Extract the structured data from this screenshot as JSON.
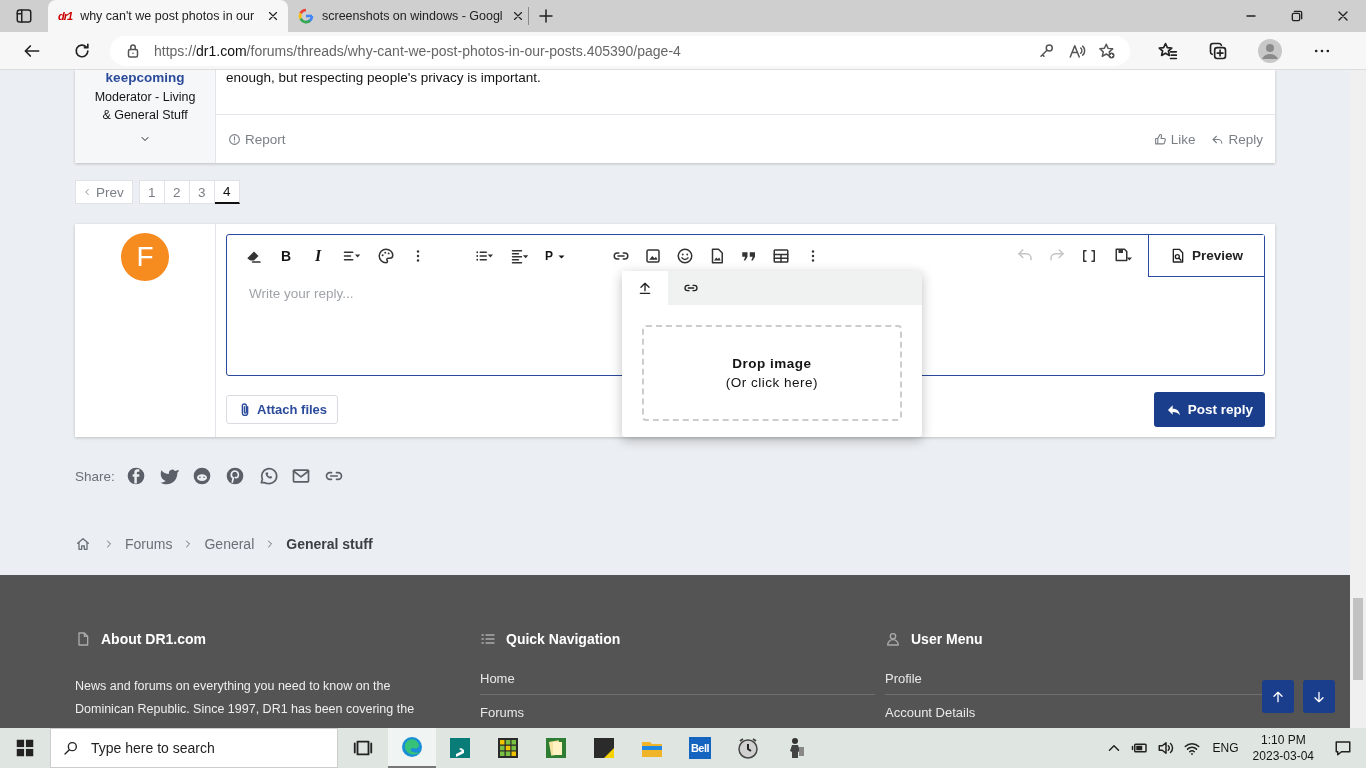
{
  "browser": {
    "tabs": [
      {
        "kind": "site",
        "favicon": "dr1",
        "title": "why can't we post photos in our",
        "selected": true
      },
      {
        "kind": "google",
        "title": "screenshots on windows - Googl",
        "selected": false
      }
    ],
    "url": {
      "scheme": "https://",
      "host": "dr1.com",
      "path": "/forums/threads/why-cant-we-post-photos-in-our-posts.405390/page-4"
    }
  },
  "post": {
    "username": "keepcoming",
    "role": "Moderator - Living & General Stuff",
    "text": "enough, but respecting people's privacy is important.",
    "report": "Report",
    "like": "Like",
    "reply": "Reply"
  },
  "pagination": {
    "prev": "Prev",
    "pages": [
      {
        "label": "1",
        "selected": false
      },
      {
        "label": "2",
        "selected": false
      },
      {
        "label": "3",
        "selected": false
      },
      {
        "label": "4",
        "selected": true
      }
    ]
  },
  "reply": {
    "avatar_letter": "F",
    "bold": "B",
    "italic": "I",
    "paragraph": "P",
    "placeholder": "Write your reply...",
    "preview": "Preview",
    "attach": "Attach files",
    "submit": "Post reply"
  },
  "image_popup": {
    "tabs": [
      {
        "kind": "upload",
        "selected": true
      },
      {
        "kind": "link",
        "selected": false
      }
    ],
    "title": "Drop image",
    "hint": "(Or click here)"
  },
  "share": {
    "label": "Share:"
  },
  "breadcrumb": [
    {
      "label": "Forums",
      "current": false
    },
    {
      "label": "General",
      "current": false
    },
    {
      "label": "General stuff",
      "current": true
    }
  ],
  "footer": {
    "columns": [
      {
        "kind": "about",
        "title": "About DR1.com",
        "lines": [
          "News and forums on everything you need to know on the",
          "Dominican Republic. Since 1997, DR1 has been covering the"
        ]
      },
      {
        "kind": "nav",
        "title": "Quick Navigation",
        "links": [
          "Home",
          "Forums"
        ]
      },
      {
        "kind": "user",
        "title": "User Menu",
        "links": [
          "Profile",
          "Account Details"
        ]
      }
    ]
  },
  "taskbar": {
    "search_placeholder": "Type here to search",
    "bell_label": "Bell",
    "language": "ENG",
    "time": "1:10 PM",
    "date": "2023-03-04"
  }
}
